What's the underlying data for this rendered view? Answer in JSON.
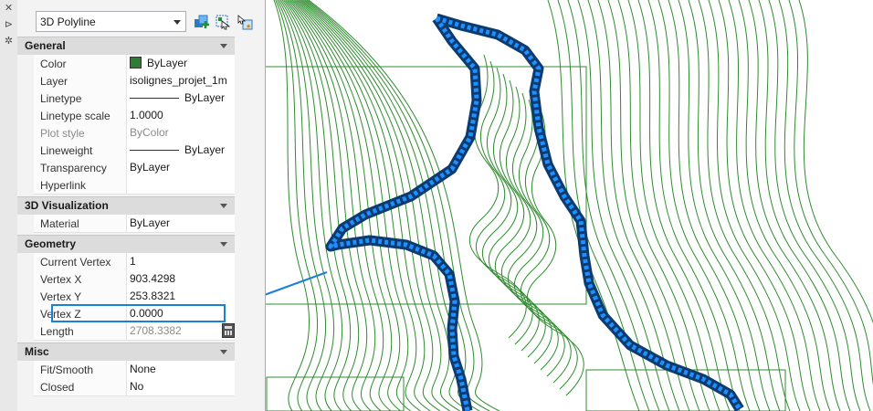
{
  "panel": {
    "object_type": "3D Polyline",
    "sections": {
      "general": {
        "title": "General",
        "rows": {
          "color": {
            "name": "Color",
            "value": "ByLayer",
            "swatch": "#2e7d32"
          },
          "layer": {
            "name": "Layer",
            "value": "isolignes_projet_1m"
          },
          "linetype": {
            "name": "Linetype",
            "value": "ByLayer"
          },
          "ltscale": {
            "name": "Linetype scale",
            "value": "1.0000"
          },
          "plotstyle": {
            "name": "Plot style",
            "value": "ByColor"
          },
          "lineweight": {
            "name": "Lineweight",
            "value": "ByLayer"
          },
          "transparency": {
            "name": "Transparency",
            "value": "ByLayer"
          },
          "hyperlink": {
            "name": "Hyperlink",
            "value": ""
          }
        }
      },
      "viz": {
        "title": "3D Visualization",
        "rows": {
          "material": {
            "name": "Material",
            "value": "ByLayer"
          }
        }
      },
      "geometry": {
        "title": "Geometry",
        "rows": {
          "current_vertex": {
            "name": "Current Vertex",
            "value": "1"
          },
          "vertex_x": {
            "name": "Vertex X",
            "value": "903.4298"
          },
          "vertex_y": {
            "name": "Vertex Y",
            "value": "253.8321"
          },
          "vertex_z": {
            "name": "Vertex Z",
            "value": "0.0000"
          },
          "length": {
            "name": "Length",
            "value": "2708.3382"
          }
        }
      },
      "misc": {
        "title": "Misc",
        "rows": {
          "fitsmooth": {
            "name": "Fit/Smooth",
            "value": "None"
          },
          "closed": {
            "name": "Closed",
            "value": "No"
          }
        }
      }
    }
  },
  "colors": {
    "contour": "#2e8b2e",
    "selection": "#1e7fd8",
    "grip": "#1e90ff",
    "highlight": "#1e7fd8"
  },
  "icons": [
    "close-icon",
    "autohide-icon",
    "properties-icon",
    "quick-select-icon",
    "select-objects-icon",
    "toggle-pickadd-icon",
    "calculator-icon"
  ]
}
